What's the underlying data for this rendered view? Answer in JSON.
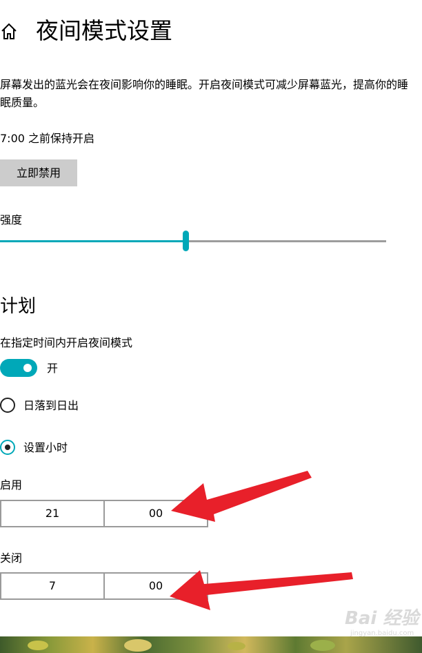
{
  "header": {
    "title": "夜间模式设置",
    "home_icon": "home-icon"
  },
  "description": "屏幕发出的蓝光会在夜间影响你的睡眠。开启夜间模式可减少屏幕蓝光，提高你的睡眠质量。",
  "status": {
    "text": "7:00 之前保持开启",
    "disable_button_label": "立即禁用"
  },
  "strength": {
    "label": "强度",
    "value_percent": 48
  },
  "schedule": {
    "heading": "计划",
    "toggle_label": "在指定时间内开启夜间模式",
    "toggle_state_label": "开",
    "toggle_on": true,
    "options": [
      {
        "label": "日落到日出",
        "selected": false
      },
      {
        "label": "设置小时",
        "selected": true
      }
    ],
    "turn_on": {
      "label": "启用",
      "hour": "21",
      "minute": "00"
    },
    "turn_off": {
      "label": "关闭",
      "hour": "7",
      "minute": "00"
    }
  },
  "watermark": {
    "logo_text": "Bai 经验",
    "url": "jingyan.baidu.com"
  },
  "colors": {
    "accent": "#00a8b8",
    "arrow": "#e8202a",
    "button_bg": "#cccccc",
    "track_inactive": "#9c9c9c"
  }
}
